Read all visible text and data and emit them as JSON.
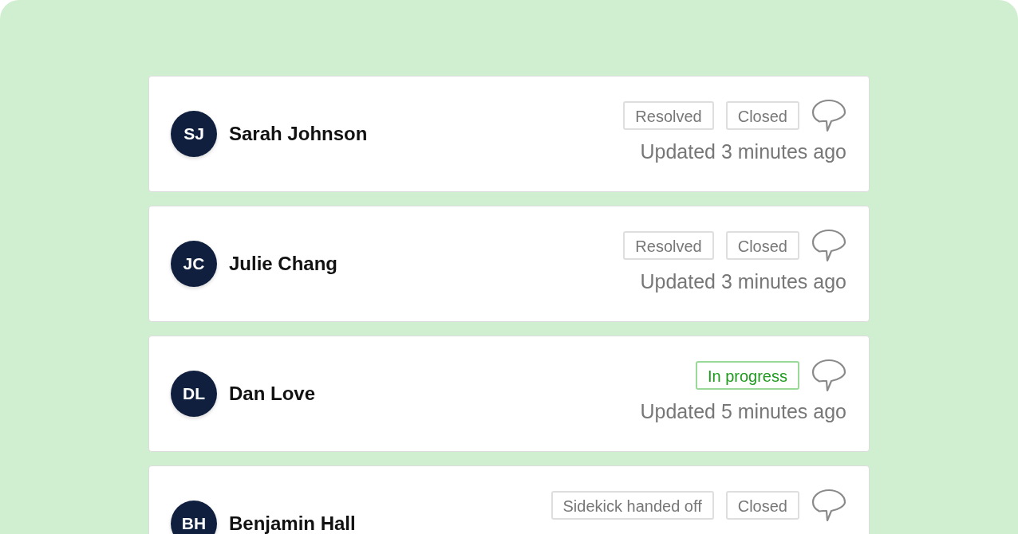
{
  "tickets": [
    {
      "initials": "SJ",
      "name": "Sarah Johnson",
      "tags": [
        {
          "label": "Resolved",
          "kind": "neutral"
        },
        {
          "label": "Closed",
          "kind": "neutral"
        }
      ],
      "updated": "Updated 3 minutes ago"
    },
    {
      "initials": "JC",
      "name": "Julie Chang",
      "tags": [
        {
          "label": "Resolved",
          "kind": "neutral"
        },
        {
          "label": "Closed",
          "kind": "neutral"
        }
      ],
      "updated": "Updated 3 minutes ago"
    },
    {
      "initials": "DL",
      "name": "Dan Love",
      "tags": [
        {
          "label": "In progress",
          "kind": "success"
        }
      ],
      "updated": "Updated 5 minutes ago"
    },
    {
      "initials": "BH",
      "name": "Benjamin Hall",
      "tags": [
        {
          "label": "Sidekick handed off",
          "kind": "neutral"
        },
        {
          "label": "Closed",
          "kind": "neutral"
        }
      ]
    }
  ]
}
